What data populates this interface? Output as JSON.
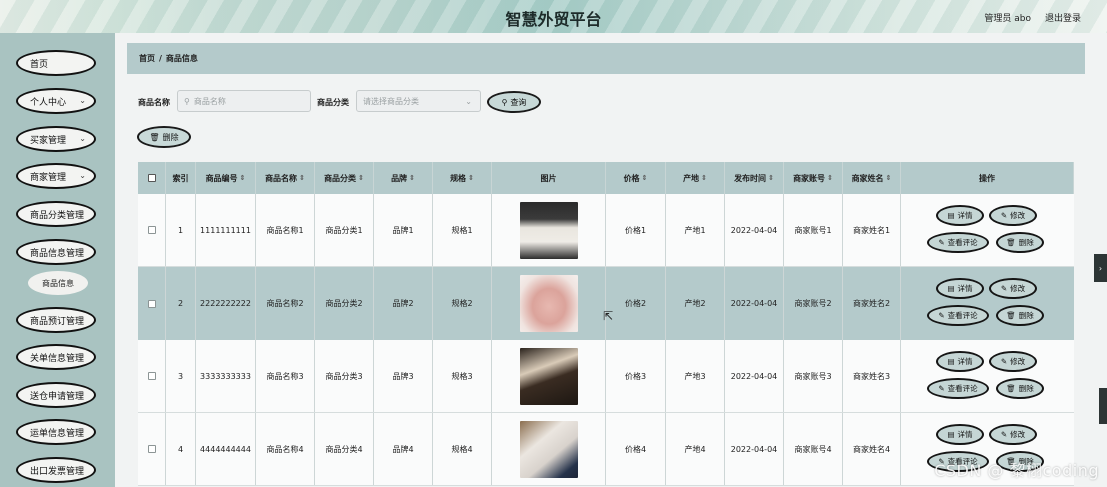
{
  "header": {
    "title": "智慧外贸平台",
    "user": "管理员 abo",
    "logout": "退出登录"
  },
  "sidebar": {
    "items": [
      {
        "label": "首页",
        "chevron": false
      },
      {
        "label": "个人中心",
        "chevron": true
      },
      {
        "label": "买家管理",
        "chevron": true
      },
      {
        "label": "商家管理",
        "chevron": true
      },
      {
        "label": "商品分类管理",
        "chevron": false
      },
      {
        "label": "商品信息管理",
        "chevron": false
      },
      {
        "label": "商品预订管理",
        "chevron": false
      },
      {
        "label": "关单信息管理",
        "chevron": false
      },
      {
        "label": "送仓申请管理",
        "chevron": false
      },
      {
        "label": "运单信息管理",
        "chevron": false
      },
      {
        "label": "出口发票管理",
        "chevron": false
      }
    ],
    "sub_item": "商品信息"
  },
  "breadcrumb": {
    "home": "首页",
    "sep": "/",
    "current": "商品信息"
  },
  "search": {
    "name_label": "商品名称",
    "name_placeholder": "商品名称",
    "category_label": "商品分类",
    "category_placeholder": "请选择商品分类",
    "query_button": "查询",
    "delete_button": "删除"
  },
  "table": {
    "columns": [
      "索引",
      "商品编号",
      "商品名称",
      "商品分类",
      "品牌",
      "规格",
      "图片",
      "价格",
      "产地",
      "发布时间",
      "商家账号",
      "商家姓名",
      "操作"
    ],
    "rows": [
      {
        "index": "1",
        "code": "1111111111",
        "name": "商品名称1",
        "category": "商品分类1",
        "brand": "品牌1",
        "spec": "规格1",
        "price": "价格1",
        "origin": "产地1",
        "date": "2022-04-04",
        "account": "商家账号1",
        "merchant": "商家姓名1"
      },
      {
        "index": "2",
        "code": "2222222222",
        "name": "商品名称2",
        "category": "商品分类2",
        "brand": "品牌2",
        "spec": "规格2",
        "price": "价格2",
        "origin": "产地2",
        "date": "2022-04-04",
        "account": "商家账号2",
        "merchant": "商家姓名2"
      },
      {
        "index": "3",
        "code": "3333333333",
        "name": "商品名称3",
        "category": "商品分类3",
        "brand": "品牌3",
        "spec": "规格3",
        "price": "价格3",
        "origin": "产地3",
        "date": "2022-04-04",
        "account": "商家账号3",
        "merchant": "商家姓名3"
      },
      {
        "index": "4",
        "code": "4444444444",
        "name": "商品名称4",
        "category": "商品分类4",
        "brand": "品牌4",
        "spec": "规格4",
        "price": "价格4",
        "origin": "产地4",
        "date": "2022-04-04",
        "account": "商家账号4",
        "merchant": "商家姓名4"
      }
    ],
    "actions": {
      "detail": "详情",
      "edit": "修改",
      "review": "查看评论",
      "delete": "删除"
    }
  },
  "watermark": "CSDN @ 黎栩coding",
  "colors": {
    "sidebar": "#a9c3c1",
    "header_band": "#b4cacb",
    "button": "#c5d6d5"
  }
}
